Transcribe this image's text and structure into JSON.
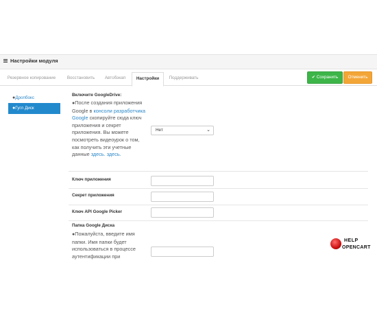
{
  "panel": {
    "title": "Настройки модуля"
  },
  "tabs": [
    {
      "label": "Резервное копирование"
    },
    {
      "label": "Восстановить"
    },
    {
      "label": "Автобэкап"
    },
    {
      "label": "Настройки"
    },
    {
      "label": "Поддерживать"
    }
  ],
  "toolbar": {
    "save_label": "Сохранить",
    "cancel_label": "Отменить"
  },
  "sidebar": {
    "items": [
      {
        "label": "Дропбокс"
      },
      {
        "label": "Гугл Диск"
      }
    ]
  },
  "form": {
    "enable": {
      "label": "Включите GoogleDrive:",
      "help_prefix": "После создания приложения Google в",
      "help_link1": "консоли разработчика Google",
      "help_middle": "скопируйте сюда ключ приложения и секрет приложения. Вы можете посмотреть видеоурок о том, как получить эти учетные данные",
      "help_link2": "здесь.",
      "help_link3": "здесь.",
      "select_value": "Нет"
    },
    "app_key_label": "Ключ приложения",
    "app_secret_label": "Секрет приложения",
    "picker_key_label": "Ключ API Google Picker",
    "folder": {
      "label": "Папка Google Диска",
      "help": "Пожалуйста, введите имя папки. Имя папки будет использоваться в процессе аутентификации при"
    }
  },
  "logo": {
    "line1": "HELP",
    "line2": "OPENCART"
  },
  "icons": {
    "panel": "list-icon",
    "save": "check-icon",
    "cancel": "close-icon",
    "info": "info-circle-icon",
    "select": "chevron-down-icon"
  }
}
